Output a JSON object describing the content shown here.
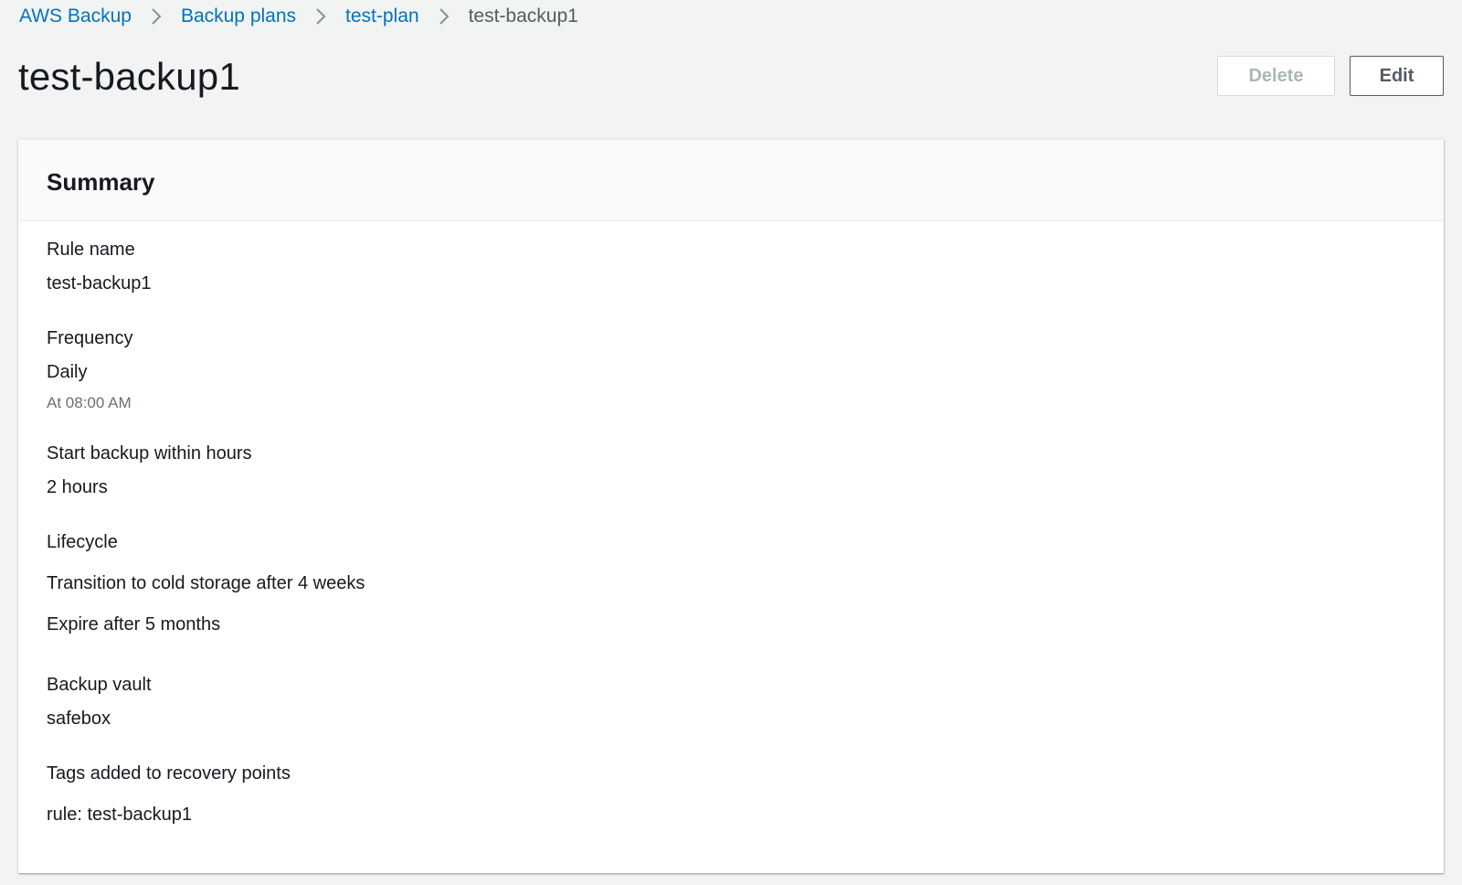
{
  "breadcrumb": {
    "items": [
      {
        "label": "AWS Backup"
      },
      {
        "label": "Backup plans"
      },
      {
        "label": "test-plan"
      },
      {
        "label": "test-backup1"
      }
    ]
  },
  "header": {
    "title": "test-backup1",
    "delete_label": "Delete",
    "edit_label": "Edit"
  },
  "summary": {
    "title": "Summary",
    "rule_name": {
      "label": "Rule name",
      "value": "test-backup1"
    },
    "frequency": {
      "label": "Frequency",
      "value": "Daily",
      "detail": "At 08:00 AM"
    },
    "start_within": {
      "label": "Start backup within hours",
      "value": "2 hours"
    },
    "lifecycle": {
      "label": "Lifecycle",
      "transition": "Transition to cold storage after 4 weeks",
      "expire": "Expire after 5 months"
    },
    "vault": {
      "label": "Backup vault",
      "value": "safebox"
    },
    "tags": {
      "label": "Tags added to recovery points",
      "value": "rule: test-backup1"
    }
  },
  "colors": {
    "link": "#0073bb",
    "text": "#16191f",
    "muted": "#545b64",
    "background": "#f2f3f3",
    "panel": "#ffffff"
  },
  "icons": {
    "breadcrumb_separator": "chevron-right-icon"
  }
}
